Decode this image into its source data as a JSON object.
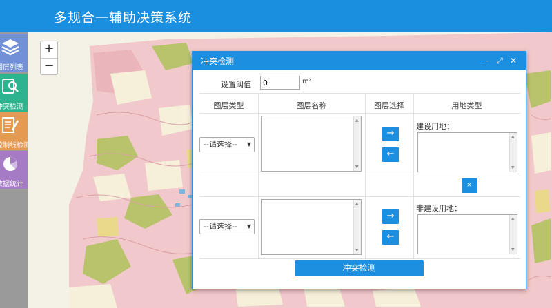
{
  "header": {
    "title": "多规合一辅助决策系统"
  },
  "sidebar": {
    "items": [
      {
        "label": "图层列表",
        "icon": "layers-icon"
      },
      {
        "label": "冲突检测",
        "icon": "conflict-check-icon"
      },
      {
        "label": "控制线检测",
        "icon": "document-edit-icon"
      },
      {
        "label": "数据统计",
        "icon": "pie-chart-icon"
      }
    ]
  },
  "map": {
    "zoom_in": "+",
    "zoom_out": "−"
  },
  "dialog": {
    "title": "冲突检测",
    "threshold_label": "设置阈值",
    "threshold_value": "0",
    "threshold_unit": "m²",
    "columns": [
      "图层类型",
      "图层名称",
      "图层选择",
      "用地类型"
    ],
    "select_placeholder": "--请选择--",
    "construction_label": "建设用地：",
    "non_construction_label": "非建设用地：",
    "arrow_right": "→",
    "arrow_left": "←",
    "clear_label": "×",
    "submit_label": "冲突检测",
    "minimize": "—",
    "maximize": "⤢",
    "close": "✕"
  }
}
